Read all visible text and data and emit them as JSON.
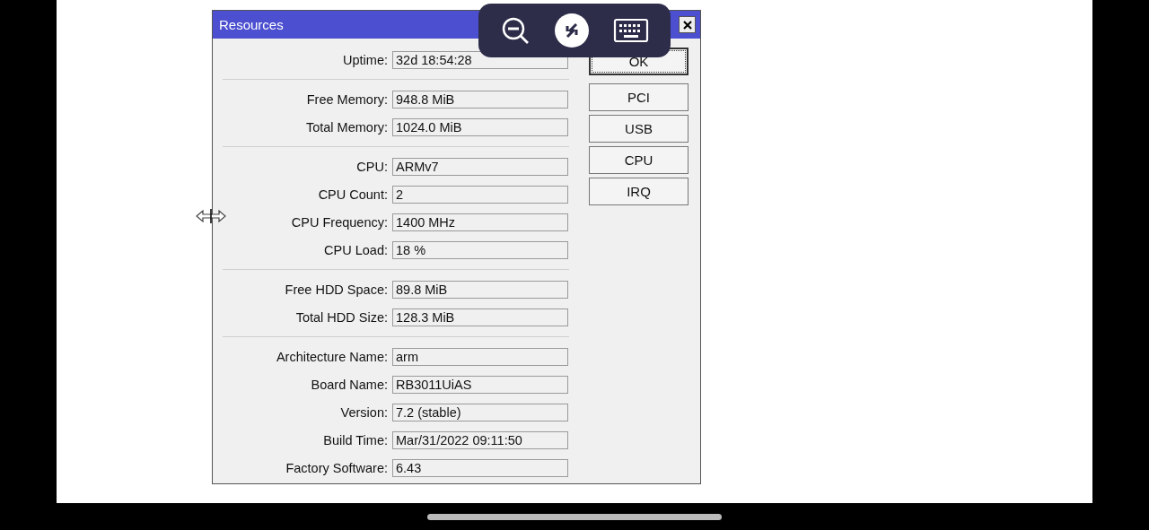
{
  "window": {
    "title": "Resources"
  },
  "groups": [
    {
      "fields": [
        {
          "label": "Uptime:",
          "value": "32d 18:54:28"
        }
      ]
    },
    {
      "fields": [
        {
          "label": "Free Memory:",
          "value": "948.8 MiB"
        },
        {
          "label": "Total Memory:",
          "value": "1024.0 MiB"
        }
      ]
    },
    {
      "fields": [
        {
          "label": "CPU:",
          "value": "ARMv7"
        },
        {
          "label": "CPU Count:",
          "value": "2"
        },
        {
          "label": "CPU Frequency:",
          "value": "1400 MHz"
        },
        {
          "label": "CPU Load:",
          "value": "18 %"
        }
      ]
    },
    {
      "fields": [
        {
          "label": "Free HDD Space:",
          "value": "89.8 MiB"
        },
        {
          "label": "Total HDD Size:",
          "value": "128.3 MiB"
        }
      ]
    },
    {
      "fields": [
        {
          "label": "Architecture Name:",
          "value": "arm"
        },
        {
          "label": "Board Name:",
          "value": "RB3011UiAS"
        },
        {
          "label": "Version:",
          "value": "7.2 (stable)"
        },
        {
          "label": "Build Time:",
          "value": "Mar/31/2022 09:11:50"
        },
        {
          "label": "Factory Software:",
          "value": "6.43"
        }
      ]
    }
  ],
  "buttons": [
    {
      "label": "OK",
      "kind": "default"
    },
    {
      "label": "PCI",
      "kind": "normal"
    },
    {
      "label": "USB",
      "kind": "normal"
    },
    {
      "label": "CPU",
      "kind": "normal"
    },
    {
      "label": "IRQ",
      "kind": "normal"
    }
  ]
}
